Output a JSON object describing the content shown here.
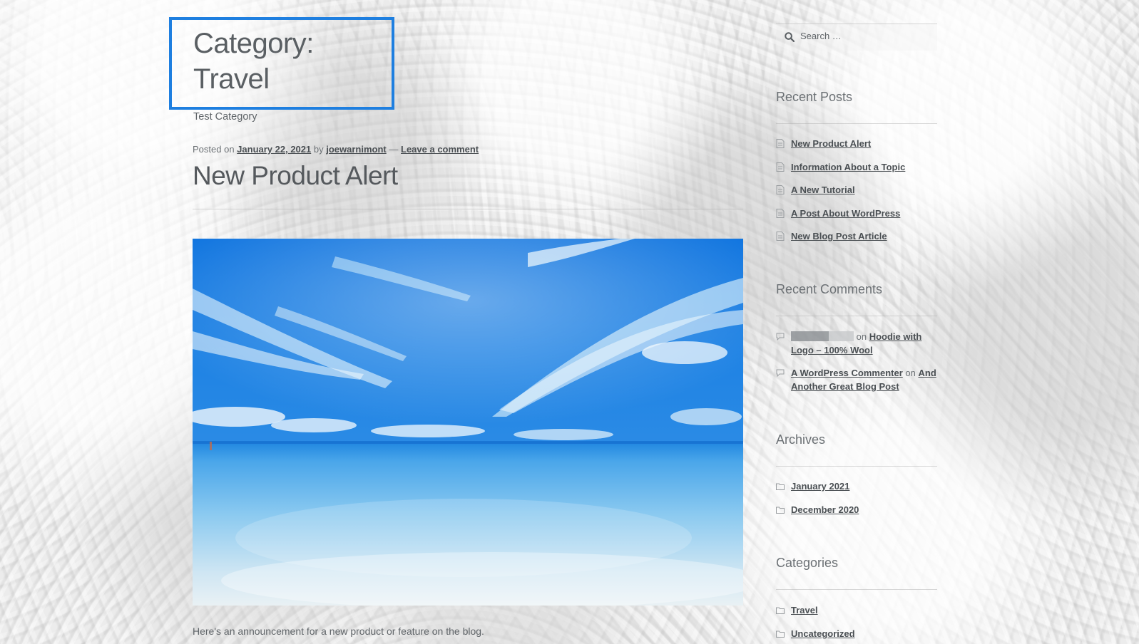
{
  "archive": {
    "title": "Category: Travel",
    "description": "Test Category"
  },
  "post": {
    "meta_prefix": "Posted on",
    "date": "January 22, 2021",
    "by": "by",
    "author": "joewarnimont",
    "dash": "—",
    "comment_link": "Leave a comment",
    "title": "New Product Alert",
    "excerpt": "Here's an announcement for a new product or feature on the blog."
  },
  "sidebar": {
    "search": {
      "placeholder": "Search …",
      "icon": "search-icon"
    },
    "recent_posts": {
      "title": "Recent Posts",
      "items": [
        "New Product Alert",
        "Information About a Topic",
        "A New Tutorial",
        "A Post About WordPress",
        "New Blog Post Article"
      ]
    },
    "recent_comments": {
      "title": "Recent Comments",
      "items": [
        {
          "author": "",
          "on": "on",
          "post": "Hoodie with Logo – 100% Wool"
        },
        {
          "author": "A WordPress Commenter",
          "on": "on",
          "post": "And Another Great Blog Post"
        }
      ]
    },
    "archives": {
      "title": "Archives",
      "items": [
        "January 2021",
        "December 2020"
      ]
    },
    "categories": {
      "title": "Categories",
      "items": [
        "Travel",
        "Uncategorized"
      ]
    }
  },
  "colors": {
    "highlight_border": "#1e7fe0",
    "link": "#4a4f53",
    "text": "#5f6468",
    "sky": "#1479e0"
  }
}
